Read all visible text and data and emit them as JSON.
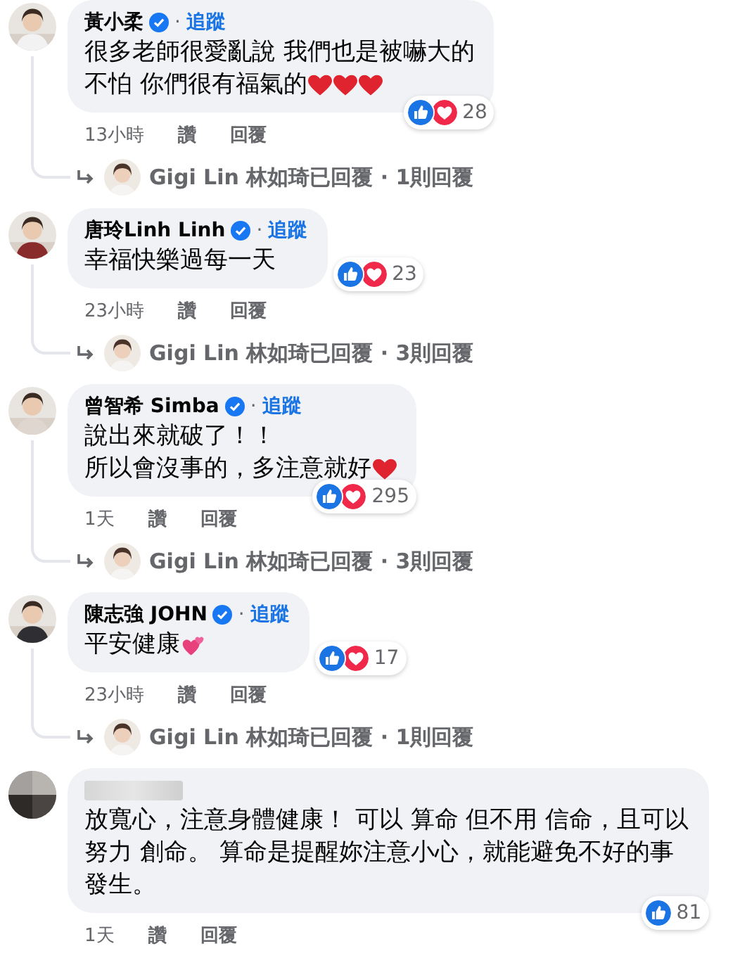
{
  "comments": [
    {
      "redacted": false,
      "author": "黃小柔",
      "verified": true,
      "dot": "·",
      "follow": "追蹤",
      "lines": [
        {
          "text": "很多老師很愛亂說 我們也是被嚇大的"
        },
        {
          "text": "不怕 你們很有福氣的",
          "emoji": [
            {
              "kind": "heart"
            },
            {
              "kind": "heart"
            },
            {
              "kind": "heart"
            }
          ]
        }
      ],
      "reactions": [
        {
          "kind": "like"
        },
        {
          "kind": "love"
        }
      ],
      "count": "28",
      "time": "13小時",
      "like": "讚",
      "reply": "回覆",
      "thread": "Gigi Lin 林如琦已回覆 · 1則回覆"
    },
    {
      "redacted": false,
      "author": "唐玲Linh Linh",
      "verified": true,
      "dot": "·",
      "follow": "追蹤",
      "lines": [
        {
          "text": "幸福快樂過每一天"
        }
      ],
      "reactions": [
        {
          "kind": "like"
        },
        {
          "kind": "love"
        }
      ],
      "count": "23",
      "time": "23小時",
      "like": "讚",
      "reply": "回覆",
      "thread": "Gigi Lin 林如琦已回覆 · 3則回覆"
    },
    {
      "redacted": false,
      "author": "曾智希 Simba",
      "verified": true,
      "dot": "·",
      "follow": "追蹤",
      "lines": [
        {
          "text": "說出來就破了！！"
        },
        {
          "text": "所以會沒事的，多注意就好",
          "emoji": [
            {
              "kind": "heart"
            }
          ]
        }
      ],
      "reactions": [
        {
          "kind": "like"
        },
        {
          "kind": "love"
        }
      ],
      "count": "295",
      "time": "1天",
      "like": "讚",
      "reply": "回覆",
      "thread": "Gigi Lin 林如琦已回覆 · 3則回覆"
    },
    {
      "redacted": false,
      "author": "陳志強 JOHN",
      "verified": true,
      "dot": "·",
      "follow": "追蹤",
      "lines": [
        {
          "text": "平安健康",
          "emoji": [
            {
              "kind": "two-hearts"
            }
          ]
        }
      ],
      "reactions": [
        {
          "kind": "like"
        },
        {
          "kind": "love"
        }
      ],
      "count": "17",
      "time": "23小時",
      "like": "讚",
      "reply": "回覆",
      "thread": "Gigi Lin 林如琦已回覆 · 1則回覆"
    },
    {
      "redacted": true,
      "lines": [
        {
          "text": "放寬心，注意身體健康！ 可以 算命 但不用 信命，且可以"
        },
        {
          "text": "努力 創命。 算命是提醒妳注意小心，就能避免不好的事"
        },
        {
          "text": "發生。"
        }
      ],
      "reactions": [
        {
          "kind": "like"
        }
      ],
      "count": "81",
      "time": "1天",
      "like": "讚",
      "reply": "回覆"
    }
  ]
}
